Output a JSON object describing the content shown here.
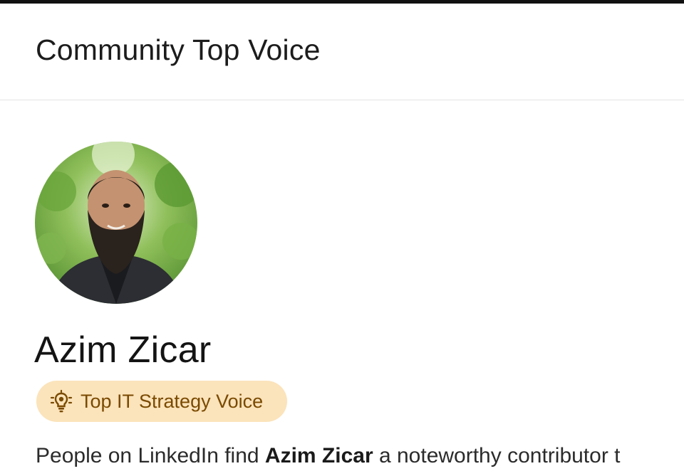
{
  "header": {
    "title": "Community Top Voice"
  },
  "profile": {
    "name": "Azim Zicar",
    "avatar_icon": "profile-photo"
  },
  "badge": {
    "icon": "lightbulb-icon",
    "label": "Top IT Strategy Voice",
    "background_color": "#fbe3bb",
    "text_color": "#7a4a00"
  },
  "description": {
    "prefix": "People on LinkedIn find ",
    "name": "Azim Zicar",
    "suffix": " a noteworthy contributor t"
  }
}
